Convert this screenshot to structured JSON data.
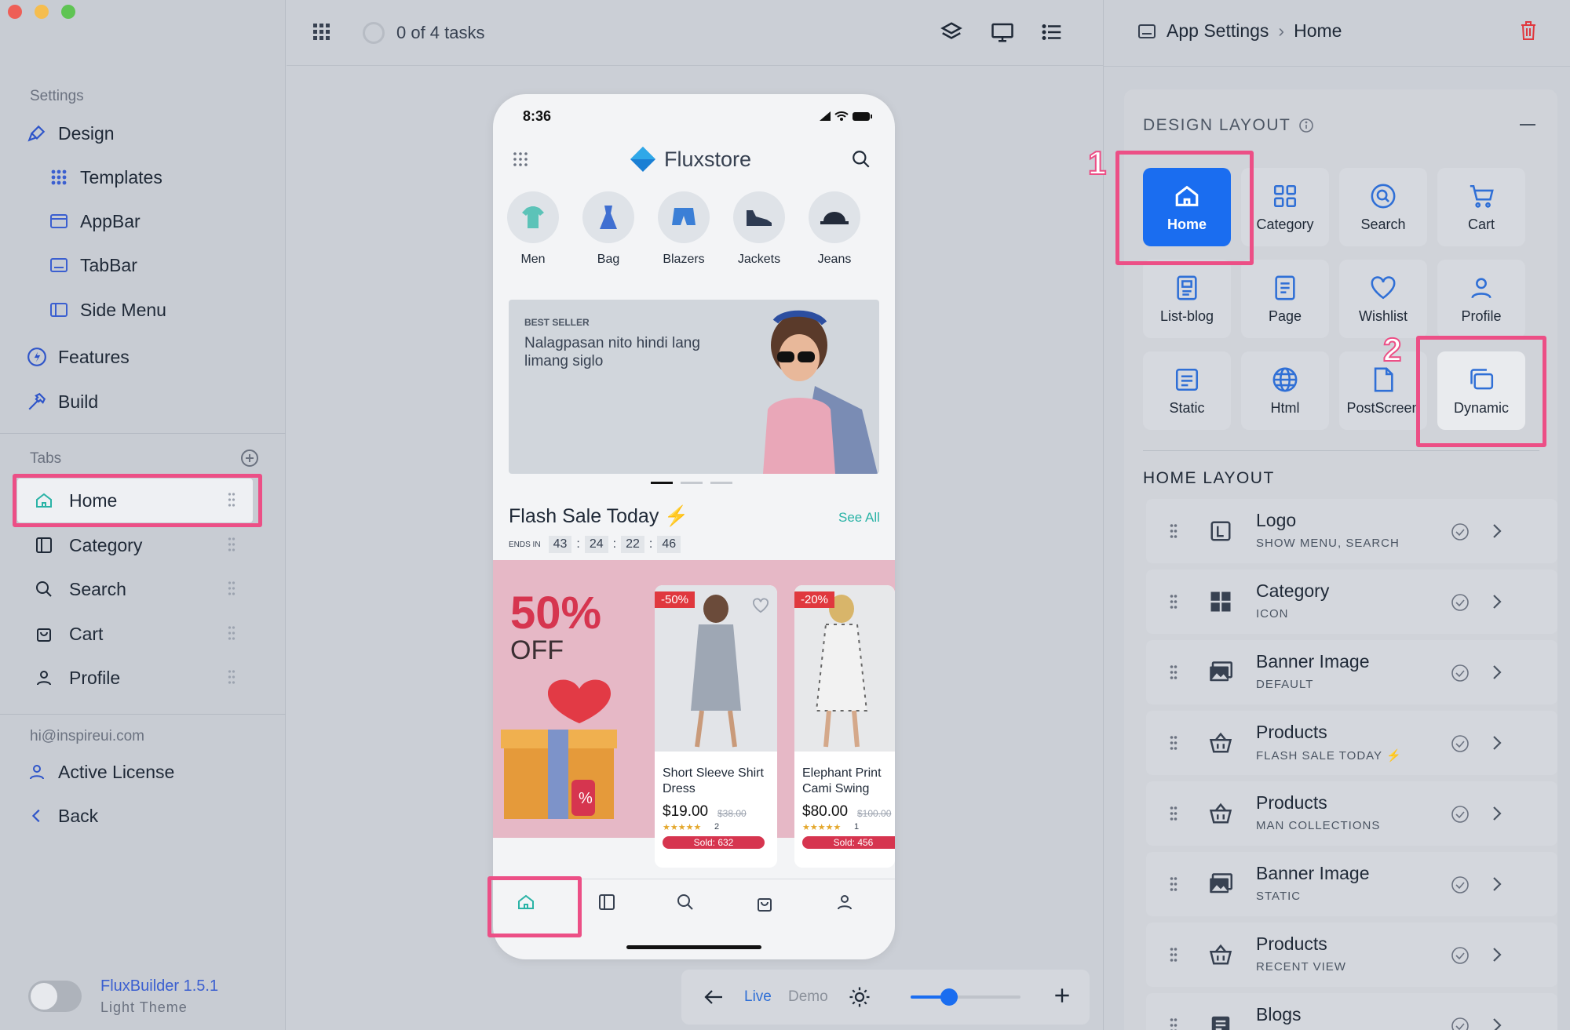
{
  "window": {
    "traffic": [
      "#ee5f57",
      "#f5bd4f",
      "#5fc453"
    ]
  },
  "sidebar": {
    "settings_label": "Settings",
    "items": [
      {
        "label": "Design",
        "icon": "brush-icon"
      },
      {
        "label": "Templates",
        "icon": "grid-icon"
      },
      {
        "label": "AppBar",
        "icon": "window-icon"
      },
      {
        "label": "TabBar",
        "icon": "tabbar-icon"
      },
      {
        "label": "Side Menu",
        "icon": "side-menu-icon"
      },
      {
        "label": "Features",
        "icon": "bolt-icon"
      },
      {
        "label": "Build",
        "icon": "hammer-icon"
      }
    ],
    "tabs_label": "Tabs",
    "tabs": [
      "Home",
      "Category",
      "Search",
      "Cart",
      "Profile"
    ],
    "email": "hi@inspireui.com",
    "license": "Active License",
    "back": "Back",
    "app_name": "FluxBuilder 1.5.1",
    "theme": "Light Theme"
  },
  "topbar": {
    "tasks": "0 of 4 tasks"
  },
  "phone": {
    "time": "8:36",
    "brand": "Fluxstore",
    "categories": [
      "Men",
      "Bag",
      "Blazers",
      "Jackets",
      "Jeans"
    ],
    "banner_tag": "BEST SELLER",
    "banner_text": "Nalagpasan nito hindi lang limang siglo",
    "flash_title": "Flash Sale Today ⚡",
    "see_all": "See All",
    "ends_in": "ENDS IN",
    "timer": [
      "43",
      "24",
      "22",
      "46"
    ],
    "promo_pct": "50%",
    "promo_off": "OFF",
    "products": [
      {
        "badge": "-50%",
        "name": "Short Sleeve Shirt Dress",
        "price": "$19.00",
        "old": "$38.00",
        "stars": "★★★★★",
        "reviews": "2",
        "sold": "Sold: 632"
      },
      {
        "badge": "-20%",
        "name": "Elephant Print Cami Swing",
        "price": "$80.00",
        "old": "$100.00",
        "stars": "★★★★★",
        "reviews": "1",
        "sold": "Sold: 456"
      }
    ]
  },
  "bottombar": {
    "live": "Live",
    "demo": "Demo",
    "zoom": 0.35
  },
  "rpanel": {
    "crumb1": "App Settings",
    "sep": "›",
    "crumb2": "Home",
    "design_layout": "DESIGN LAYOUT",
    "tiles": [
      "Home",
      "Category",
      "Search",
      "Cart",
      "List-blog",
      "Page",
      "Wishlist",
      "Profile",
      "Static",
      "Html",
      "PostScreen",
      "Dynamic"
    ],
    "home_layout": "HOME LAYOUT",
    "layout_items": [
      {
        "title": "Logo",
        "sub": "SHOW MENU, SEARCH"
      },
      {
        "title": "Category",
        "sub": "ICON"
      },
      {
        "title": "Banner Image",
        "sub": "DEFAULT"
      },
      {
        "title": "Products",
        "sub": "FLASH SALE TODAY ⚡"
      },
      {
        "title": "Products",
        "sub": "MAN COLLECTIONS"
      },
      {
        "title": "Banner Image",
        "sub": "STATIC"
      },
      {
        "title": "Products",
        "sub": "RECENT VIEW"
      },
      {
        "title": "Blogs",
        "sub": ""
      }
    ]
  },
  "annotations": [
    "1",
    "2"
  ],
  "colors": {
    "accent": "#1a6df0",
    "highlight": "#ec4f86",
    "link": "#3b5fd0",
    "sale": "#e0383e",
    "teal": "#2ab3a6"
  }
}
